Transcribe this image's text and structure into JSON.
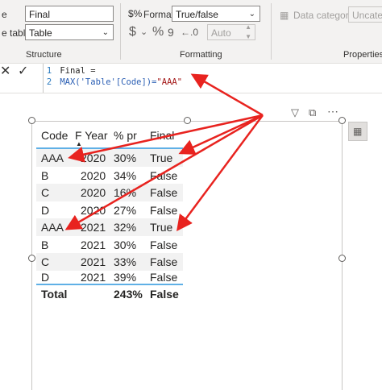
{
  "ribbon": {
    "name_label": "e",
    "name_value": "Final",
    "home_table_label": "e table",
    "home_table_value": "Table",
    "structure_label": "Structure",
    "format_label": "Format",
    "format_value": "True/false",
    "currency_symbol": "$",
    "percent_symbol": "%",
    "comma_symbol": "9",
    "auto_value": "Auto",
    "formatting_label": "Formatting",
    "data_category_label": "Data category",
    "data_category_value": "Uncateg",
    "properties_label": "Properties"
  },
  "formula": {
    "line1_number": "1",
    "line1_text": "Final =",
    "line2_number": "2",
    "line2_func": "MAX('Table'[Code])=",
    "line2_string": "\"AAA\""
  },
  "table": {
    "headers": [
      "Code",
      "F Year",
      "% pr",
      "Final"
    ],
    "rows": [
      [
        "AAA",
        "2020",
        "30%",
        "True"
      ],
      [
        "B",
        "2020",
        "34%",
        "False"
      ],
      [
        "C",
        "2020",
        "16%",
        "False"
      ],
      [
        "D",
        "2020",
        "27%",
        "False"
      ],
      [
        "AAA",
        "2021",
        "32%",
        "True"
      ],
      [
        "B",
        "2021",
        "30%",
        "False"
      ],
      [
        "C",
        "2021",
        "33%",
        "False"
      ],
      [
        "D",
        "2021",
        "39%",
        "False"
      ]
    ],
    "total": [
      "Total",
      "",
      "243%",
      "False"
    ]
  },
  "colors": {
    "arrow": "#e8231f",
    "accent": "#5fb0e6"
  }
}
